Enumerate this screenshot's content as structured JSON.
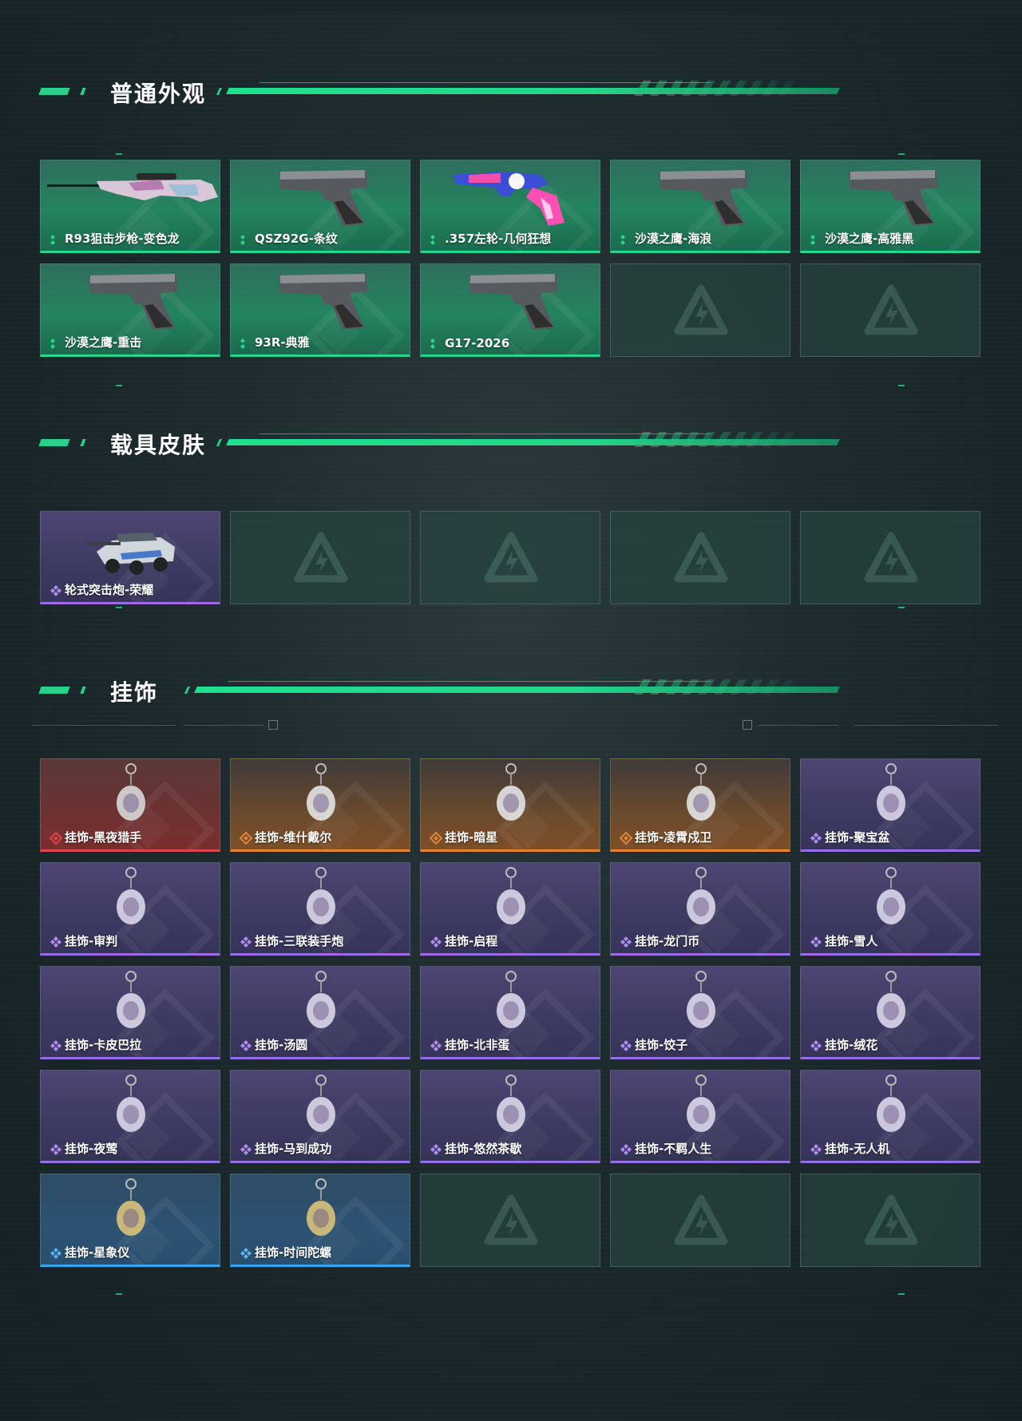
{
  "sections": [
    {
      "title": "普通外观",
      "items": [
        {
          "label": "R93狙击步枪-变色龙",
          "rarity": "green",
          "icon": "sniper-rifle-icon"
        },
        {
          "label": "QSZ92G-条纹",
          "rarity": "green",
          "icon": "pistol-icon"
        },
        {
          "label": ".357左轮-几何狂想",
          "rarity": "green",
          "icon": "revolver-icon"
        },
        {
          "label": "沙漠之鹰-海浪",
          "rarity": "green",
          "icon": "pistol-icon"
        },
        {
          "label": "沙漠之鹰-高雅黑",
          "rarity": "green",
          "icon": "pistol-icon"
        },
        {
          "label": "沙漠之鹰-重击",
          "rarity": "green",
          "icon": "pistol-icon"
        },
        {
          "label": "93R-典雅",
          "rarity": "green",
          "icon": "pistol-icon"
        },
        {
          "label": "G17-2026",
          "rarity": "green",
          "icon": "pistol-icon"
        }
      ],
      "empty_slots": 2
    },
    {
      "title": "载具皮肤",
      "items": [
        {
          "label": "轮式突击炮-荣耀",
          "rarity": "purple",
          "icon": "armored-vehicle-icon"
        }
      ],
      "empty_slots": 4
    },
    {
      "title": "挂饰",
      "items": [
        {
          "label": "挂饰-黑夜猎手",
          "rarity": "red",
          "icon": "charm-icon"
        },
        {
          "label": "挂饰-维什戴尔",
          "rarity": "orange",
          "icon": "charm-icon"
        },
        {
          "label": "挂饰-暗星",
          "rarity": "orange",
          "icon": "charm-icon"
        },
        {
          "label": "挂饰-凌霄戍卫",
          "rarity": "orange",
          "icon": "charm-icon"
        },
        {
          "label": "挂饰-聚宝盆",
          "rarity": "purple",
          "icon": "charm-icon"
        },
        {
          "label": "挂饰-审判",
          "rarity": "purple",
          "icon": "charm-icon"
        },
        {
          "label": "挂饰-三联装手炮",
          "rarity": "purple",
          "icon": "charm-icon"
        },
        {
          "label": "挂饰-启程",
          "rarity": "purple",
          "icon": "charm-icon"
        },
        {
          "label": "挂饰-龙门币",
          "rarity": "purple",
          "icon": "charm-icon"
        },
        {
          "label": "挂饰-雪人",
          "rarity": "purple",
          "icon": "charm-icon"
        },
        {
          "label": "挂饰-卡皮巴拉",
          "rarity": "purple",
          "icon": "charm-icon"
        },
        {
          "label": "挂饰-汤圆",
          "rarity": "purple",
          "icon": "charm-icon"
        },
        {
          "label": "挂饰-北非蛋",
          "rarity": "purple",
          "icon": "charm-icon"
        },
        {
          "label": "挂饰-饺子",
          "rarity": "purple",
          "icon": "charm-icon"
        },
        {
          "label": "挂饰-绒花",
          "rarity": "purple",
          "icon": "charm-icon"
        },
        {
          "label": "挂饰-夜莺",
          "rarity": "purple",
          "icon": "charm-icon"
        },
        {
          "label": "挂饰-马到成功",
          "rarity": "purple",
          "icon": "charm-icon"
        },
        {
          "label": "挂饰-悠然茶歇",
          "rarity": "purple",
          "icon": "charm-icon"
        },
        {
          "label": "挂饰-不羁人生",
          "rarity": "purple",
          "icon": "charm-icon"
        },
        {
          "label": "挂饰-无人机",
          "rarity": "purple",
          "icon": "charm-icon"
        },
        {
          "label": "挂饰-星象仪",
          "rarity": "blue",
          "icon": "charm-icon"
        },
        {
          "label": "挂饰-时间陀螺",
          "rarity": "blue",
          "icon": "charm-icon"
        }
      ],
      "empty_slots": 3
    }
  ],
  "colors": {
    "accent": "#27d18a",
    "rarity_green": "#2bd38b",
    "rarity_purple": "#9a6ce0",
    "rarity_red": "#e04646",
    "rarity_orange": "#e0843a",
    "rarity_blue": "#3fa4e6"
  }
}
